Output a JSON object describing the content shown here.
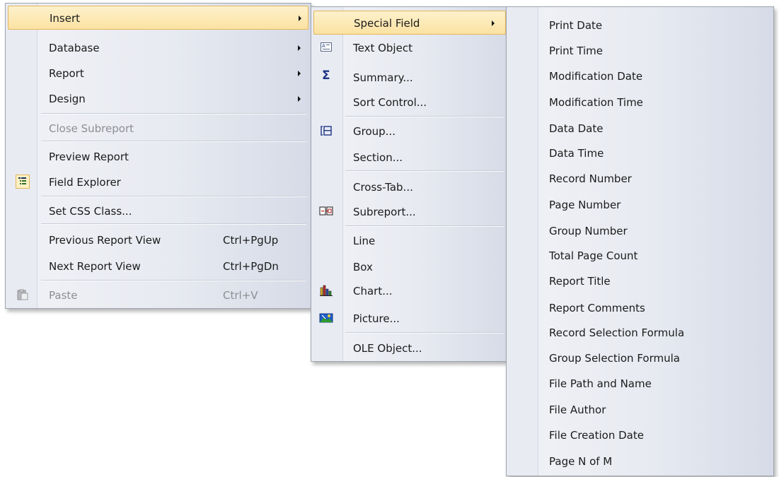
{
  "main_menu": {
    "items": [
      {
        "label": "Insert",
        "submenu": true
      },
      {
        "label": "Database",
        "submenu": true
      },
      {
        "label": "Report",
        "submenu": true
      },
      {
        "label": "Design",
        "submenu": true
      },
      {
        "label": "Close Subreport",
        "disabled": true
      },
      {
        "label": "Preview Report"
      },
      {
        "label": "Field Explorer",
        "icon": "field-explorer-icon"
      },
      {
        "label": "Set CSS Class..."
      },
      {
        "label": "Previous Report View",
        "shortcut": "Ctrl+PgUp"
      },
      {
        "label": "Next Report View",
        "shortcut": "Ctrl+PgDn"
      },
      {
        "label": "Paste",
        "shortcut": "Ctrl+V",
        "disabled": true,
        "icon": "paste-icon"
      }
    ]
  },
  "insert_menu": {
    "items": [
      {
        "label": "Special Field",
        "submenu": true
      },
      {
        "label": "Text Object",
        "icon": "text-object-icon"
      },
      {
        "label": "Summary...",
        "icon": "sigma-icon"
      },
      {
        "label": "Sort Control..."
      },
      {
        "label": "Group...",
        "icon": "group-icon"
      },
      {
        "label": "Section..."
      },
      {
        "label": "Cross-Tab..."
      },
      {
        "label": "Subreport...",
        "icon": "subreport-icon"
      },
      {
        "label": "Line"
      },
      {
        "label": "Box"
      },
      {
        "label": "Chart...",
        "icon": "chart-icon"
      },
      {
        "label": "Picture...",
        "icon": "picture-icon"
      },
      {
        "label": "OLE Object..."
      }
    ]
  },
  "special_field_menu": {
    "items": [
      "Print Date",
      "Print Time",
      "Modification Date",
      "Modification Time",
      "Data Date",
      "Data Time",
      "Record Number",
      "Page Number",
      "Group Number",
      "Total Page Count",
      "Report Title",
      "Report Comments",
      "Record Selection Formula",
      "Group Selection Formula",
      "File Path and Name",
      "File Author",
      "File Creation Date",
      "Page N of M"
    ]
  },
  "colors": {
    "highlight": "#fbe2a2",
    "highlight_border": "#e3b65a",
    "disabled_text": "#8c8e93",
    "gutter": "#e9ebf2"
  }
}
